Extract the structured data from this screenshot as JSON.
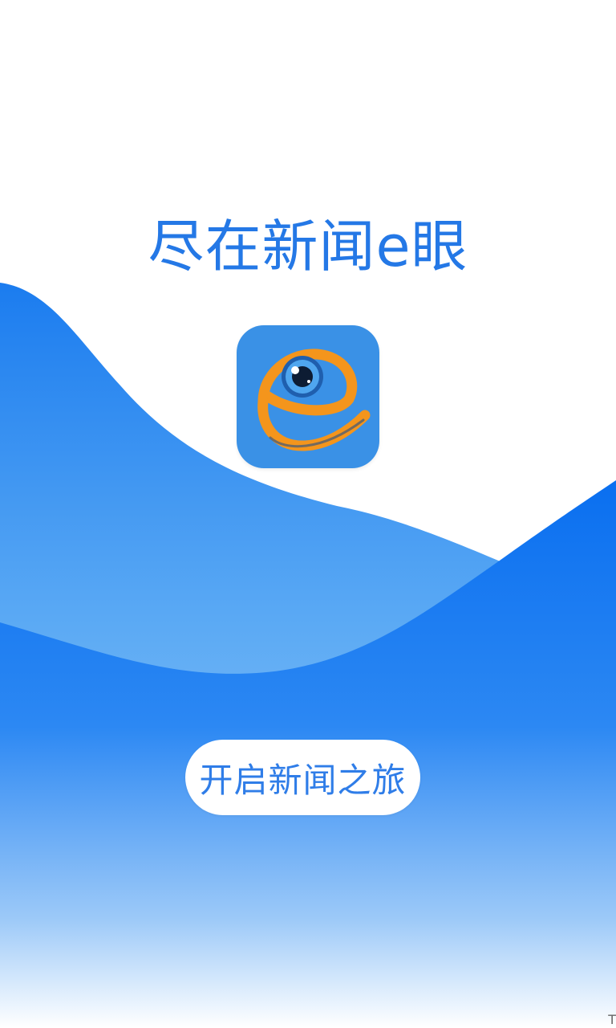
{
  "headline": {
    "text": "尽在新闻e眼"
  },
  "app_icon": {
    "name": "news-e-eye-logo-icon"
  },
  "start_button": {
    "label": "开启新闻之旅"
  },
  "corner_glyph": {
    "text": "T"
  },
  "colors": {
    "primary_blue": "#1a79f0",
    "headline_blue": "#2478e6",
    "button_text_blue": "#2f7de8",
    "icon_background": "#3a91e6",
    "icon_orange": "#f4951c",
    "wave_light_blue": "#8cc4f7",
    "wave_deep_blue": "#0a6ff0"
  }
}
